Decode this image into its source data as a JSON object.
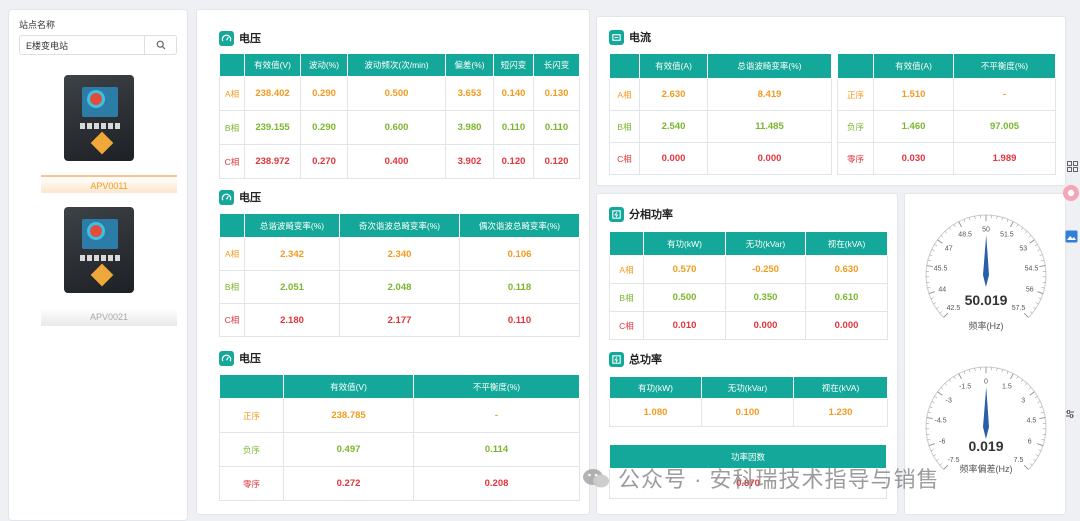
{
  "station": {
    "label": "站点名称",
    "search_value": "E楼变电站",
    "devices": [
      {
        "name": "APV0011"
      },
      {
        "name": "APV0021"
      }
    ]
  },
  "voltage1": {
    "title": "电压",
    "headers": [
      "",
      "有效值(V)",
      "波动(%)",
      "波动频次(次/min)",
      "偏差(%)",
      "短闪变",
      "长闪变"
    ],
    "rows": [
      [
        "A相",
        "238.402",
        "0.290",
        "0.500",
        "3.653",
        "0.140",
        "0.130"
      ],
      [
        "B相",
        "239.155",
        "0.290",
        "0.600",
        "3.980",
        "0.110",
        "0.110"
      ],
      [
        "C相",
        "238.972",
        "0.270",
        "0.400",
        "3.902",
        "0.120",
        "0.120"
      ]
    ]
  },
  "voltage2": {
    "title": "电压",
    "headers": [
      "",
      "总谐波畸变率(%)",
      "奇次谐波总畸变率(%)",
      "偶次谐波总畸变率(%)"
    ],
    "rows": [
      [
        "A相",
        "2.342",
        "2.340",
        "0.106"
      ],
      [
        "B相",
        "2.051",
        "2.048",
        "0.118"
      ],
      [
        "C相",
        "2.180",
        "2.177",
        "0.110"
      ]
    ]
  },
  "voltage3": {
    "title": "电压",
    "headers": [
      "",
      "有效值(V)",
      "不平衡度(%)"
    ],
    "rows": [
      [
        "正序",
        "238.785",
        "-"
      ],
      [
        "负序",
        "0.497",
        "0.114"
      ],
      [
        "零序",
        "0.272",
        "0.208"
      ]
    ]
  },
  "current": {
    "title": "电流",
    "table1": {
      "headers": [
        "",
        "有效值(A)",
        "总谐波畸变率(%)"
      ],
      "rows": [
        [
          "A相",
          "2.630",
          "8.419"
        ],
        [
          "B相",
          "2.540",
          "11.485"
        ],
        [
          "C相",
          "0.000",
          "0.000"
        ]
      ]
    },
    "table2": {
      "headers": [
        "",
        "有效值(A)",
        "不平衡度(%)"
      ],
      "rows": [
        [
          "正序",
          "1.510",
          "-"
        ],
        [
          "负序",
          "1.460",
          "97.005"
        ],
        [
          "零序",
          "0.030",
          "1.989"
        ]
      ]
    }
  },
  "phase_power": {
    "title": "分相功率",
    "headers": [
      "",
      "有功(kW)",
      "无功(kVar)",
      "视在(kVA)"
    ],
    "rows": [
      [
        "A相",
        "0.570",
        "-0.250",
        "0.630"
      ],
      [
        "B相",
        "0.500",
        "0.350",
        "0.610"
      ],
      [
        "C相",
        "0.010",
        "0.000",
        "0.000"
      ]
    ]
  },
  "total_power": {
    "title": "总功率",
    "headers": [
      "有功(kW)",
      "无功(kVar)",
      "视在(kVA)"
    ],
    "values": [
      "1.080",
      "0.100",
      "1.230"
    ],
    "pf_label": "功率因数",
    "pf_value": "0.870"
  },
  "gauges": [
    {
      "value": "50.019",
      "label": "频率(Hz)",
      "min": 42.5,
      "max": 57.5,
      "val": 50.019,
      "ticks": [
        "42.5",
        "44",
        "45.5",
        "47",
        "48.5",
        "50",
        "51.5",
        "53",
        "54.5",
        "56",
        "57.5"
      ]
    },
    {
      "value": "0.019",
      "label": "频率偏差(Hz)",
      "min": -7.5,
      "max": 7.5,
      "val": 0.019,
      "ticks": [
        "-7.5",
        "-6",
        "-4.5",
        "-3",
        "-1.5",
        "0",
        "1.5",
        "3",
        "4.5",
        "6",
        "7.5"
      ]
    }
  ],
  "watermark": "公众号 · 安科瑞技术指导与销售",
  "colors": {
    "header": "#14a89a",
    "orange": "#f39a1f",
    "green": "#7ab62d",
    "red": "#e2343b"
  }
}
